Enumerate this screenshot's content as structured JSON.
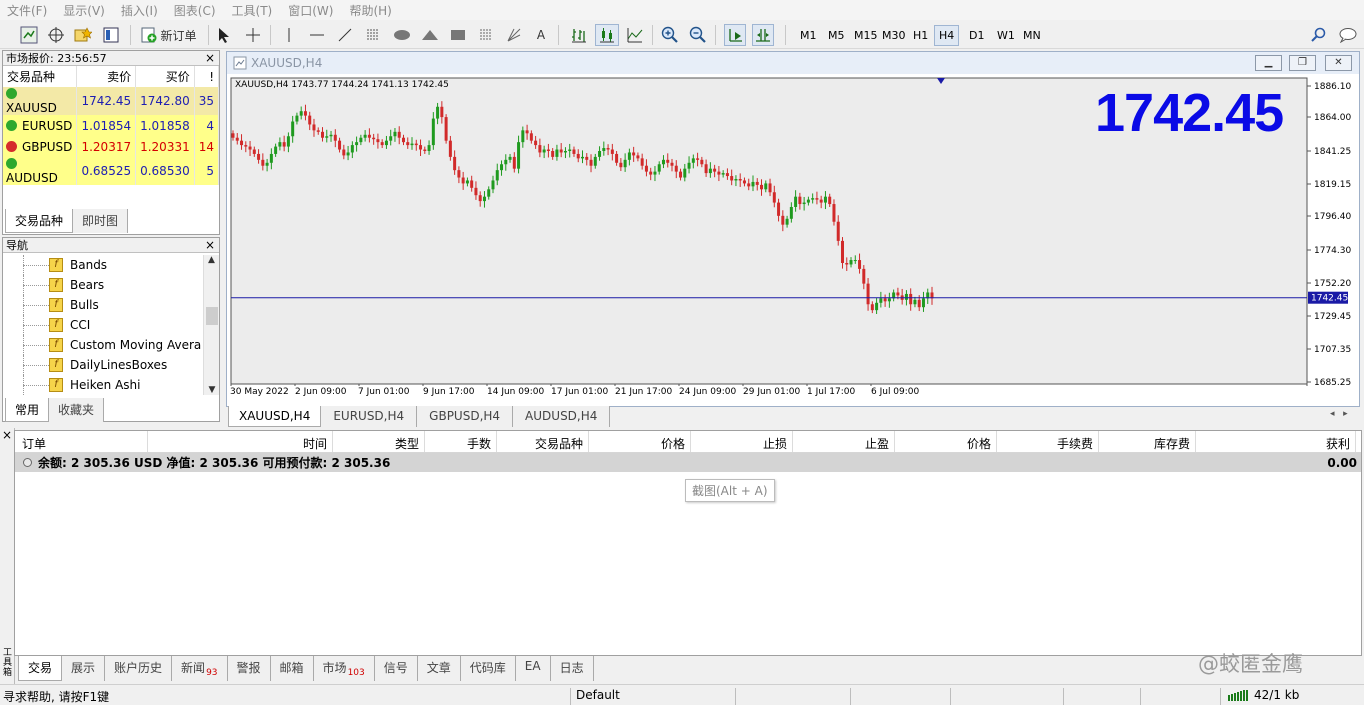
{
  "menu": [
    "文件(F)",
    "显示(V)",
    "插入(I)",
    "图表(C)",
    "工具(T)",
    "窗口(W)",
    "帮助(H)"
  ],
  "toolbar": {
    "new_order": "新订单",
    "periods": [
      "M1",
      "M5",
      "M15",
      "M30",
      "H1",
      "H4",
      "D1",
      "W1",
      "MN"
    ],
    "active_period": "H4",
    "text_tool": "A"
  },
  "market_watch": {
    "title": "市场报价: 23:56:57",
    "headers": [
      "交易品种",
      "卖价",
      "买价",
      "!"
    ],
    "rows": [
      {
        "symbol": "XAUUSD",
        "bid": "1742.45",
        "ask": "1742.80",
        "spread": "35",
        "dir": "up",
        "color": "blue"
      },
      {
        "symbol": "EURUSD",
        "bid": "1.01854",
        "ask": "1.01858",
        "spread": "4",
        "dir": "up",
        "color": "blue"
      },
      {
        "symbol": "GBPUSD",
        "bid": "1.20317",
        "ask": "1.20331",
        "spread": "14",
        "dir": "down",
        "color": "red"
      },
      {
        "symbol": "AUDUSD",
        "bid": "0.68525",
        "ask": "0.68530",
        "spread": "5",
        "dir": "up",
        "color": "blue"
      }
    ],
    "tabs": [
      "交易品种",
      "即时图"
    ]
  },
  "navigator": {
    "title": "导航",
    "items": [
      "Bands",
      "Bears",
      "Bulls",
      "CCI",
      "Custom Moving Avera",
      "DailyLinesBoxes",
      "Heiken Ashi"
    ],
    "tabs": [
      "常用",
      "收藏夹"
    ]
  },
  "chart_window": {
    "caption": "XAUUSD,H4",
    "info": "XAUUSD,H4  1743.77 1744.24 1741.13 1742.45",
    "big_price": "1742.45",
    "price_label": "1742.45",
    "tabs": [
      "XAUUSD,H4",
      "EURUSD,H4",
      "GBPUSD,H4",
      "AUDUSD,H4"
    ]
  },
  "chart_data": {
    "type": "candlestick",
    "symbol": "XAUUSD",
    "timeframe": "H4",
    "y_ticks": [
      "1886.10",
      "1864.00",
      "1841.25",
      "1819.15",
      "1796.40",
      "1774.30",
      "1752.20",
      "1729.45",
      "1707.35",
      "1685.25"
    ],
    "ylim": [
      1685.25,
      1886.1
    ],
    "x_ticks": [
      "30 May 2022",
      "2 Jun 09:00",
      "7 Jun 01:00",
      "9 Jun 17:00",
      "14 Jun 09:00",
      "17 Jun 01:00",
      "21 Jun 17:00",
      "24 Jun 09:00",
      "29 Jun 01:00",
      "1 Jul 17:00",
      "6 Jul 09:00"
    ],
    "current_price": 1742.45,
    "closes": [
      1851,
      1849,
      1846,
      1845,
      1843,
      1840,
      1836,
      1832,
      1834,
      1840,
      1845,
      1848,
      1845,
      1852,
      1862,
      1866,
      1869,
      1866,
      1860,
      1856,
      1855,
      1851,
      1852,
      1853,
      1849,
      1843,
      1839,
      1841,
      1846,
      1848,
      1851,
      1853,
      1851,
      1850,
      1848,
      1846,
      1849,
      1852,
      1855,
      1851,
      1848,
      1846,
      1847,
      1846,
      1843,
      1842,
      1846,
      1864,
      1872,
      1865,
      1849,
      1838,
      1829,
      1824,
      1820,
      1822,
      1817,
      1812,
      1808,
      1811,
      1816,
      1822,
      1829,
      1833,
      1836,
      1838,
      1830,
      1848,
      1856,
      1854,
      1849,
      1846,
      1841,
      1843,
      1842,
      1838,
      1843,
      1841,
      1842,
      1843,
      1840,
      1837,
      1838,
      1836,
      1832,
      1838,
      1842,
      1844,
      1843,
      1840,
      1834,
      1831,
      1836,
      1841,
      1839,
      1837,
      1832,
      1828,
      1826,
      1828,
      1833,
      1836,
      1834,
      1832,
      1828,
      1824,
      1830,
      1834,
      1837,
      1836,
      1833,
      1827,
      1830,
      1828,
      1826,
      1827,
      1825,
      1822,
      1823,
      1822,
      1820,
      1818,
      1821,
      1819,
      1816,
      1820,
      1814,
      1807,
      1798,
      1792,
      1796,
      1804,
      1811,
      1806,
      1807,
      1809,
      1810,
      1809,
      1807,
      1811,
      1806,
      1794,
      1781,
      1766,
      1765,
      1768,
      1768,
      1762,
      1752,
      1738,
      1734,
      1739,
      1742,
      1740,
      1742,
      1746,
      1744,
      1741,
      1745,
      1738,
      1741,
      1736,
      1742,
      1746,
      1742
    ]
  },
  "terminal": {
    "headers": [
      "订单",
      "时间",
      "类型",
      "手数",
      "交易品种",
      "价格",
      "止损",
      "止盈",
      "价格",
      "手续费",
      "库存费",
      "获利"
    ],
    "balance_text": "余额: 2 305.36 USD  净值: 2 305.36  可用预付款: 2 305.36",
    "profit": "0.00",
    "tooltip": "截图(Alt + A)",
    "side_label": "工具箱",
    "tabs": [
      {
        "label": "交易",
        "badge": ""
      },
      {
        "label": "展示",
        "badge": ""
      },
      {
        "label": "账户历史",
        "badge": ""
      },
      {
        "label": "新闻",
        "badge": "93"
      },
      {
        "label": "警报",
        "badge": ""
      },
      {
        "label": "邮箱",
        "badge": ""
      },
      {
        "label": "市场",
        "badge": "103"
      },
      {
        "label": "信号",
        "badge": ""
      },
      {
        "label": "文章",
        "badge": ""
      },
      {
        "label": "代码库",
        "badge": ""
      },
      {
        "label": "EA",
        "badge": ""
      },
      {
        "label": "日志",
        "badge": ""
      }
    ]
  },
  "watermark": "@蛟匿金鹰",
  "status": {
    "help": "寻求帮助, 请按F1键",
    "profile": "Default",
    "traffic": "42/1 kb"
  },
  "colors": {
    "bull": "#1f9a1f",
    "bear": "#d12a2a",
    "price_line": "#1a1aa6",
    "big_price": "#0a0ae6"
  }
}
